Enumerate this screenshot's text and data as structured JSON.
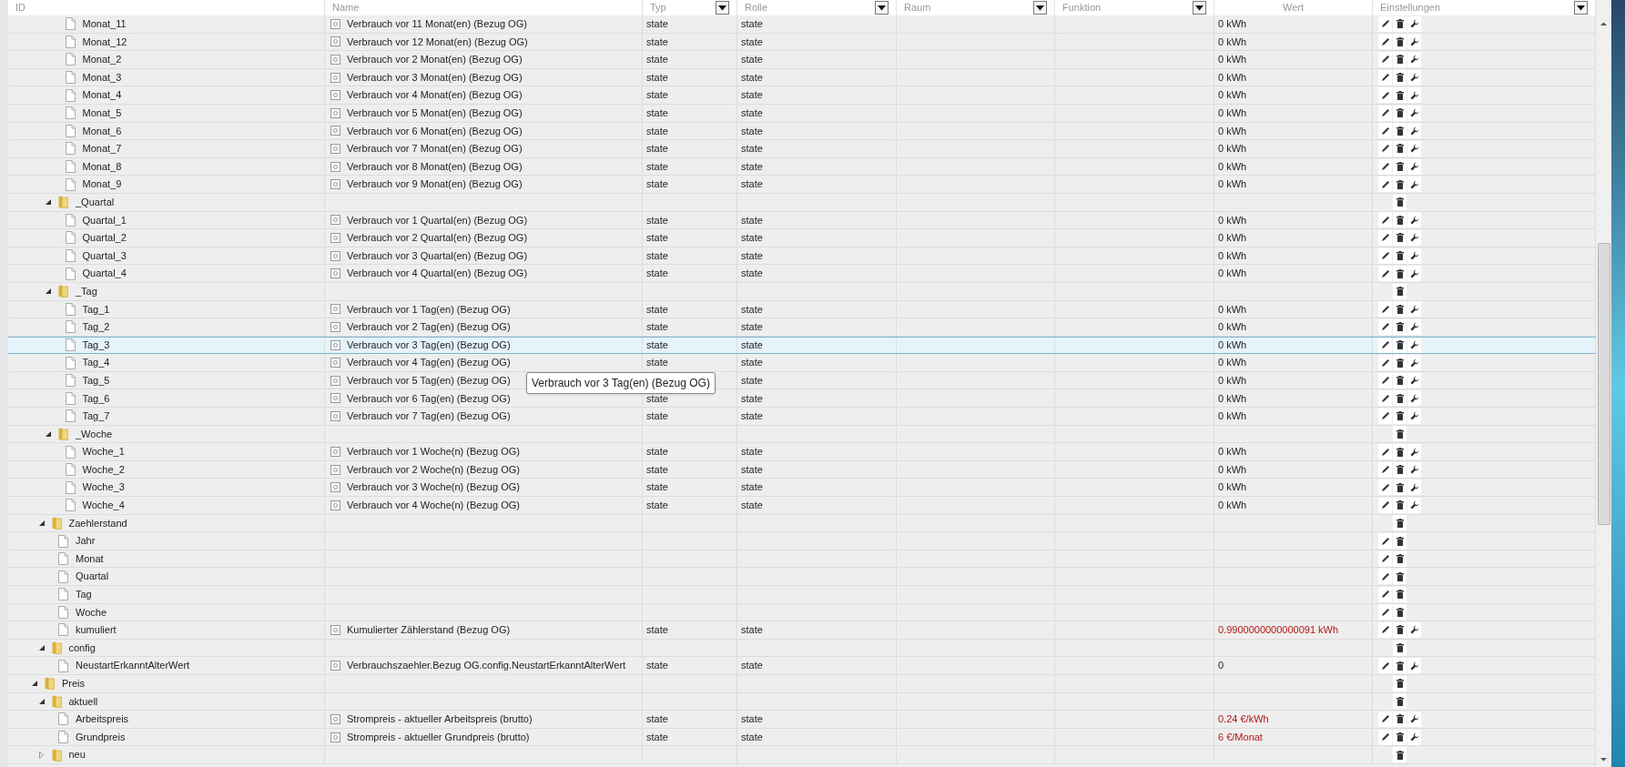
{
  "columns": [
    {
      "label": "ID",
      "filter": false
    },
    {
      "label": "Name",
      "filter": false
    },
    {
      "label": "Typ",
      "filter": true
    },
    {
      "label": "Rolle",
      "filter": true
    },
    {
      "label": "Raum",
      "filter": true
    },
    {
      "label": "Funktion",
      "filter": true
    },
    {
      "label": "Wert",
      "filter": false
    },
    {
      "label": "Einstellungen",
      "filter": true
    }
  ],
  "tree": [
    {
      "children": [
        {
          "children": [
            {
              "children": [
                {
                  "id": "Monat_11",
                  "kind": "state",
                  "name": "Verbrauch vor 11 Monat(en) (Bezug OG)",
                  "type": "state",
                  "role": "state",
                  "value": "0 kWh",
                  "acknowledged": true,
                  "editable": true,
                  "configurable": true,
                  "selected": false
                },
                {
                  "id": "Monat_12",
                  "kind": "state",
                  "name": "Verbrauch vor 12 Monat(en) (Bezug OG)",
                  "type": "state",
                  "role": "state",
                  "value": "0 kWh",
                  "acknowledged": true,
                  "editable": true,
                  "configurable": true,
                  "selected": false
                },
                {
                  "id": "Monat_2",
                  "kind": "state",
                  "name": "Verbrauch vor 2 Monat(en) (Bezug OG)",
                  "type": "state",
                  "role": "state",
                  "value": "0 kWh",
                  "acknowledged": true,
                  "editable": true,
                  "configurable": true,
                  "selected": false
                },
                {
                  "id": "Monat_3",
                  "kind": "state",
                  "name": "Verbrauch vor 3 Monat(en) (Bezug OG)",
                  "type": "state",
                  "role": "state",
                  "value": "0 kWh",
                  "acknowledged": true,
                  "editable": true,
                  "configurable": true,
                  "selected": false
                },
                {
                  "id": "Monat_4",
                  "kind": "state",
                  "name": "Verbrauch vor 4 Monat(en) (Bezug OG)",
                  "type": "state",
                  "role": "state",
                  "value": "0 kWh",
                  "acknowledged": true,
                  "editable": true,
                  "configurable": true,
                  "selected": false
                },
                {
                  "id": "Monat_5",
                  "kind": "state",
                  "name": "Verbrauch vor 5 Monat(en) (Bezug OG)",
                  "type": "state",
                  "role": "state",
                  "value": "0 kWh",
                  "acknowledged": true,
                  "editable": true,
                  "configurable": true,
                  "selected": false
                },
                {
                  "id": "Monat_6",
                  "kind": "state",
                  "name": "Verbrauch vor 6 Monat(en) (Bezug OG)",
                  "type": "state",
                  "role": "state",
                  "value": "0 kWh",
                  "acknowledged": true,
                  "editable": true,
                  "configurable": true,
                  "selected": false
                },
                {
                  "id": "Monat_7",
                  "kind": "state",
                  "name": "Verbrauch vor 7 Monat(en) (Bezug OG)",
                  "type": "state",
                  "role": "state",
                  "value": "0 kWh",
                  "acknowledged": true,
                  "editable": true,
                  "configurable": true,
                  "selected": false
                },
                {
                  "id": "Monat_8",
                  "kind": "state",
                  "name": "Verbrauch vor 8 Monat(en) (Bezug OG)",
                  "type": "state",
                  "role": "state",
                  "value": "0 kWh",
                  "acknowledged": true,
                  "editable": true,
                  "configurable": true,
                  "selected": false
                },
                {
                  "id": "Monat_9",
                  "kind": "state",
                  "name": "Verbrauch vor 9 Monat(en) (Bezug OG)",
                  "type": "state",
                  "role": "state",
                  "value": "0 kWh",
                  "acknowledged": true,
                  "editable": true,
                  "configurable": true,
                  "selected": false
                }
              ]
            },
            {
              "id": "_Quartal",
              "kind": "folder",
              "expanded": true,
              "editable": false,
              "configurable": false,
              "selected": false,
              "children": [
                {
                  "id": "Quartal_1",
                  "kind": "state",
                  "name": "Verbrauch vor 1 Quartal(en) (Bezug OG)",
                  "type": "state",
                  "role": "state",
                  "value": "0 kWh",
                  "acknowledged": true,
                  "editable": true,
                  "configurable": true,
                  "selected": false
                },
                {
                  "id": "Quartal_2",
                  "kind": "state",
                  "name": "Verbrauch vor 2 Quartal(en) (Bezug OG)",
                  "type": "state",
                  "role": "state",
                  "value": "0 kWh",
                  "acknowledged": true,
                  "editable": true,
                  "configurable": true,
                  "selected": false
                },
                {
                  "id": "Quartal_3",
                  "kind": "state",
                  "name": "Verbrauch vor 3 Quartal(en) (Bezug OG)",
                  "type": "state",
                  "role": "state",
                  "value": "0 kWh",
                  "acknowledged": true,
                  "editable": true,
                  "configurable": true,
                  "selected": false
                },
                {
                  "id": "Quartal_4",
                  "kind": "state",
                  "name": "Verbrauch vor 4 Quartal(en) (Bezug OG)",
                  "type": "state",
                  "role": "state",
                  "value": "0 kWh",
                  "acknowledged": true,
                  "editable": true,
                  "configurable": true,
                  "selected": false
                }
              ]
            },
            {
              "id": "_Tag",
              "kind": "folder",
              "expanded": true,
              "editable": false,
              "configurable": false,
              "selected": false,
              "children": [
                {
                  "id": "Tag_1",
                  "kind": "state",
                  "name": "Verbrauch vor 1 Tag(en) (Bezug OG)",
                  "type": "state",
                  "role": "state",
                  "value": "0 kWh",
                  "acknowledged": true,
                  "editable": true,
                  "configurable": true,
                  "selected": false
                },
                {
                  "id": "Tag_2",
                  "kind": "state",
                  "name": "Verbrauch vor 2 Tag(en) (Bezug OG)",
                  "type": "state",
                  "role": "state",
                  "value": "0 kWh",
                  "acknowledged": true,
                  "editable": true,
                  "configurable": true,
                  "selected": false
                },
                {
                  "id": "Tag_3",
                  "kind": "state",
                  "name": "Verbrauch vor 3 Tag(en) (Bezug OG)",
                  "type": "state",
                  "role": "state",
                  "value": "0 kWh",
                  "acknowledged": true,
                  "editable": true,
                  "configurable": true,
                  "selected": true
                },
                {
                  "id": "Tag_4",
                  "kind": "state",
                  "name": "Verbrauch vor 4 Tag(en) (Bezug OG)",
                  "type": "state",
                  "role": "state",
                  "value": "0 kWh",
                  "acknowledged": true,
                  "editable": true,
                  "configurable": true,
                  "selected": false
                },
                {
                  "id": "Tag_5",
                  "kind": "state",
                  "name": "Verbrauch vor 5 Tag(en) (Bezug OG)",
                  "role": "state",
                  "value": "0 kWh",
                  "acknowledged": true,
                  "editable": true,
                  "configurable": true,
                  "selected": false
                },
                {
                  "id": "Tag_6",
                  "kind": "state",
                  "name": "Verbrauch vor 6 Tag(en) (Bezug OG)",
                  "type": "state",
                  "role": "state",
                  "value": "0 kWh",
                  "acknowledged": true,
                  "editable": true,
                  "configurable": true,
                  "selected": false
                },
                {
                  "id": "Tag_7",
                  "kind": "state",
                  "name": "Verbrauch vor 7 Tag(en) (Bezug OG)",
                  "type": "state",
                  "role": "state",
                  "value": "0 kWh",
                  "acknowledged": true,
                  "editable": true,
                  "configurable": true,
                  "selected": false
                }
              ]
            },
            {
              "id": "_Woche",
              "kind": "folder",
              "expanded": true,
              "editable": false,
              "configurable": false,
              "selected": false,
              "children": [
                {
                  "id": "Woche_1",
                  "kind": "state",
                  "name": "Verbrauch vor 1 Woche(n) (Bezug OG)",
                  "type": "state",
                  "role": "state",
                  "value": "0 kWh",
                  "acknowledged": true,
                  "editable": true,
                  "configurable": true,
                  "selected": false
                },
                {
                  "id": "Woche_2",
                  "kind": "state",
                  "name": "Verbrauch vor 2 Woche(n) (Bezug OG)",
                  "type": "state",
                  "role": "state",
                  "value": "0 kWh",
                  "acknowledged": true,
                  "editable": true,
                  "configurable": true,
                  "selected": false
                },
                {
                  "id": "Woche_3",
                  "kind": "state",
                  "name": "Verbrauch vor 3 Woche(n) (Bezug OG)",
                  "type": "state",
                  "role": "state",
                  "value": "0 kWh",
                  "acknowledged": true,
                  "editable": true,
                  "configurable": true,
                  "selected": false
                },
                {
                  "id": "Woche_4",
                  "kind": "state",
                  "name": "Verbrauch vor 4 Woche(n) (Bezug OG)",
                  "type": "state",
                  "role": "state",
                  "value": "0 kWh",
                  "acknowledged": true,
                  "editable": true,
                  "configurable": true,
                  "selected": false
                }
              ]
            }
          ]
        },
        {
          "id": "Zaehlerstand",
          "kind": "folder",
          "expanded": true,
          "editable": false,
          "configurable": false,
          "selected": false,
          "children": [
            {
              "id": "Jahr",
              "kind": "state",
              "editable": true,
              "configurable": false,
              "selected": false
            },
            {
              "id": "Monat",
              "kind": "state",
              "editable": true,
              "configurable": false,
              "selected": false
            },
            {
              "id": "Quartal",
              "kind": "state",
              "editable": true,
              "configurable": false,
              "selected": false
            },
            {
              "id": "Tag",
              "kind": "state",
              "editable": true,
              "configurable": false,
              "selected": false
            },
            {
              "id": "Woche",
              "kind": "state",
              "editable": true,
              "configurable": false,
              "selected": false
            },
            {
              "id": "kumuliert",
              "kind": "state",
              "name": "Kumulierter Zählerstand (Bezug OG)",
              "type": "state",
              "role": "state",
              "value": "0.9900000000000091 kWh",
              "acknowledged": false,
              "editable": true,
              "configurable": true,
              "selected": false
            }
          ]
        },
        {
          "id": "config",
          "kind": "folder",
          "expanded": true,
          "editable": false,
          "configurable": false,
          "selected": false,
          "children": [
            {
              "id": "NeustartErkanntAlterWert",
              "kind": "state",
              "name": "Verbrauchszaehler.Bezug OG.config.NeustartErkanntAlterWert",
              "type": "state",
              "role": "state",
              "value": "0",
              "acknowledged": true,
              "editable": true,
              "configurable": true,
              "selected": false
            }
          ]
        }
      ]
    },
    {
      "id": "Preis",
      "kind": "folder",
      "expanded": true,
      "editable": false,
      "configurable": false,
      "selected": false,
      "children": [
        {
          "id": "aktuell",
          "kind": "folder",
          "expanded": true,
          "editable": false,
          "configurable": false,
          "selected": false,
          "children": [
            {
              "id": "Arbeitspreis",
              "kind": "state",
              "name": "Strompreis - aktueller Arbeitspreis (brutto)",
              "type": "state",
              "role": "state",
              "value": "0.24 €/kWh",
              "acknowledged": false,
              "editable": true,
              "configurable": true,
              "selected": false
            },
            {
              "id": "Grundpreis",
              "kind": "state",
              "name": "Strompreis - aktueller Grundpreis (brutto)",
              "type": "state",
              "role": "state",
              "value": "6 €/Monat",
              "acknowledged": false,
              "editable": true,
              "configurable": true,
              "selected": false
            }
          ]
        },
        {
          "id": "neu",
          "kind": "folder",
          "expanded": false,
          "editable": false,
          "configurable": false,
          "selected": false
        }
      ]
    }
  ],
  "tooltip": {
    "text": "Verbrauch vor 3 Tag(en) (Bezug OG)"
  }
}
